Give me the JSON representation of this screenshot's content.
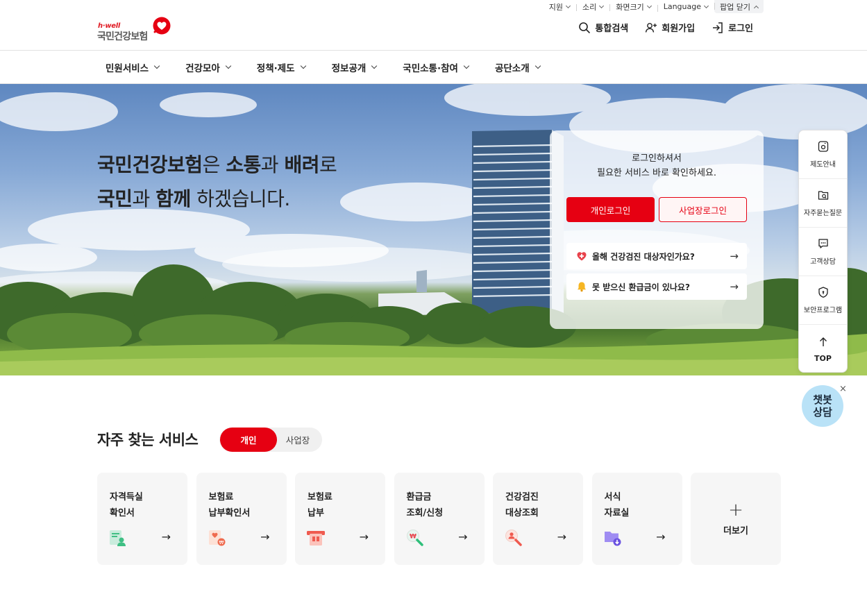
{
  "utility": {
    "items": [
      {
        "label": "지원"
      },
      {
        "label": "소리"
      },
      {
        "label": "화면크기"
      },
      {
        "label": "Language"
      }
    ],
    "popup_label": "팝업 닫기"
  },
  "logo": {
    "tagline": "h·well",
    "name": "국민건강보험"
  },
  "header": {
    "search": "통합검색",
    "signup": "회원가입",
    "login": "로그인"
  },
  "gnb": {
    "items": [
      "민원서비스",
      "건강모아",
      "정책·제도",
      "정보공개",
      "국민소통·참여",
      "공단소개"
    ]
  },
  "hero": {
    "line1": {
      "a": "국민건강보험",
      "b": "은 ",
      "c": "소통",
      "d": "과 ",
      "e": "배려",
      "f": "로"
    },
    "line2": {
      "a": "국민",
      "b": "과 ",
      "c": "함께",
      "d": " 하겠습니다."
    }
  },
  "login_card": {
    "msg1": "로그인하셔서",
    "msg2": "필요한 서비스 바로 확인하세요.",
    "personal_btn": "개인로그인",
    "biz_btn": "사업장로그인",
    "links": [
      {
        "label": "올해 건강검진 대상자인가요?",
        "icon": "heart-plus-icon"
      },
      {
        "label": "못 받으신 환급금이 있나요?",
        "icon": "bell-icon"
      }
    ],
    "arrow": "→"
  },
  "side_menu": {
    "items": [
      "제도안내",
      "자주묻는질문",
      "고객상담",
      "보안프로그램"
    ],
    "top": "TOP"
  },
  "chatbot": {
    "line1": "챗봇",
    "line2": "상담",
    "close": "×"
  },
  "services": {
    "title": "자주 찾는 서비스",
    "toggle_on": "개인",
    "toggle_off": "사업장",
    "cards": [
      {
        "l1": "자격득실",
        "l2": "확인서",
        "icon": "certificate-icon"
      },
      {
        "l1": "보험료",
        "l2": "납부확인서",
        "icon": "payment-receipt-icon"
      },
      {
        "l1": "보험료",
        "l2": "납부",
        "icon": "card-payment-icon"
      },
      {
        "l1": "환급금",
        "l2": "조회/신청",
        "icon": "refund-search-icon"
      },
      {
        "l1": "건강검진",
        "l2": "대상조회",
        "icon": "person-search-icon"
      },
      {
        "l1": "서식",
        "l2": "자료실",
        "icon": "folder-download-icon"
      }
    ],
    "more_plus": "+",
    "more_label": "더보기",
    "arrow": "→"
  },
  "colors": {
    "brand_red": "#e60012",
    "chatbot_bg": "#b9e2f7"
  }
}
